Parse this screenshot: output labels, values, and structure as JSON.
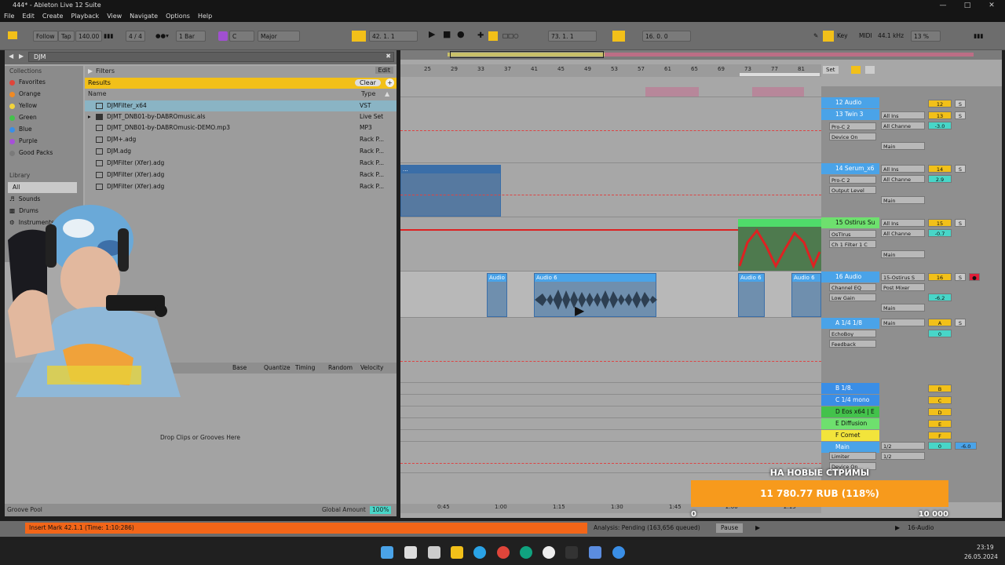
{
  "window": {
    "title": "444* - Ableton Live 12 Suite"
  },
  "menu": [
    "File",
    "Edit",
    "Create",
    "Playback",
    "View",
    "Navigate",
    "Options",
    "Help"
  ],
  "control_bar": {
    "follow": "Follow",
    "tap": "Tap",
    "tempo": "140.00",
    "time_signature": "4 / 4",
    "quantize": "1 Bar",
    "key": "C",
    "scale": "Major",
    "arrangement_position": "42.   1.   1",
    "loop_start": "73.   1.   1",
    "loop_length": "16.   0.   0",
    "key_label": "Key",
    "midi_label": "MIDI",
    "sample_rate": "44.1 kHz",
    "cpu": "13 %"
  },
  "browser": {
    "search": "DJM",
    "collections_label": "Collections",
    "collections": [
      {
        "label": "Favorites",
        "color": "#e0453a"
      },
      {
        "label": "Orange",
        "color": "#f08a24"
      },
      {
        "label": "Yellow",
        "color": "#f2d43b"
      },
      {
        "label": "Green",
        "color": "#43c24b"
      },
      {
        "label": "Blue",
        "color": "#3a8ee6"
      },
      {
        "label": "Purple",
        "color": "#a650d8"
      },
      {
        "label": "Good Packs",
        "color": "#7a7a7a"
      }
    ],
    "library_label": "Library",
    "library": [
      "All",
      "Sounds",
      "Drums",
      "Instruments"
    ],
    "filters_label": "Filters",
    "edit_label": "Edit",
    "results_label": "Results",
    "clear_label": "Clear",
    "col_name": "Name",
    "col_type": "Type",
    "results": [
      {
        "name": "DJMFilter_x64",
        "type": "VST"
      },
      {
        "name": "DJMT_DNB01-by-DABROmusic.als",
        "type": "Live Set"
      },
      {
        "name": "DJMT_DNB01-by-DABROmusic-DEMO.mp3",
        "type": "MP3"
      },
      {
        "name": "DJM+.adg",
        "type": "Rack P..."
      },
      {
        "name": "DJM.adg",
        "type": "Rack P..."
      },
      {
        "name": "DJMFilter (Xfer).adg",
        "type": "Rack P..."
      },
      {
        "name": "DJMFilter (Xfer).adg",
        "type": "Rack P..."
      },
      {
        "name": "DJMFilter (Xfer).adg",
        "type": "Rack P..."
      }
    ]
  },
  "groove": {
    "cols": [
      "Base",
      "Quantize",
      "Timing",
      "Random",
      "Velocity"
    ],
    "drop_text": "Drop Clips or Grooves Here",
    "pool_label": "Groove Pool",
    "global_amount_label": "Global Amount",
    "global_amount": "100%"
  },
  "ruler": {
    "bars": [
      "25",
      "29",
      "33",
      "37",
      "41",
      "45",
      "49",
      "53",
      "57",
      "61",
      "65",
      "69",
      "73",
      "77",
      "81"
    ],
    "times": [
      "0:45",
      "1:00",
      "1:15",
      "1:30",
      "1:45",
      "2:00",
      "2:15"
    ],
    "set_label": "Set"
  },
  "tracks": [
    {
      "name": "12 Audio",
      "color": "#4aa3e8",
      "num": "12",
      "vol": "",
      "dev1": "",
      "dev2": ""
    },
    {
      "name": "13 Twin 3",
      "color": "#4aa3e8",
      "num": "13",
      "input": "All Ins",
      "chan": "All Channe",
      "vol": "-3.0",
      "dev1": "Pro-C 2",
      "dev2": "Device On",
      "out": "Main"
    },
    {
      "name": "14 Serum_x6",
      "color": "#4aa3e8",
      "num": "14",
      "input": "All Ins",
      "chan": "All Channe",
      "vol": "2.9",
      "dev1": "Pro-C 2",
      "dev2": "Output Level",
      "out": "Main"
    },
    {
      "name": "15 Ostirus Su",
      "color": "#6ee06e",
      "num": "15",
      "input": "All Ins",
      "chan": "All Channe",
      "vol": "-0.7",
      "dev1": "OsTIrus",
      "dev2": "Ch 1 Filter 1 C",
      "out": "Main"
    },
    {
      "name": "16 Audio",
      "color": "#4aa3e8",
      "num": "16",
      "input": "15-Ostirus S",
      "chan": "Post Mixer",
      "vol": "-6.2",
      "dev1": "Channel EQ",
      "dev2": "Low Gain",
      "out": "Main"
    },
    {
      "name": "A 1/4  1/8",
      "color": "#4aa3e8",
      "num": "A",
      "input": "Main",
      "vol": "0",
      "dev1": "EchoBoy",
      "dev2": "Feedback"
    }
  ],
  "returns": [
    {
      "name": "B 1/8.",
      "color": "#3a8ee6",
      "letter": "B"
    },
    {
      "name": "C 1/4 mono",
      "color": "#3a8ee6",
      "letter": "C"
    },
    {
      "name": "D Eos x64 | E",
      "color": "#43c24b",
      "letter": "D"
    },
    {
      "name": "E Diffusion",
      "color": "#6ee06e",
      "letter": "E"
    },
    {
      "name": "F Comet",
      "color": "#f2e43b",
      "letter": "F"
    }
  ],
  "main_track": {
    "name": "Main",
    "in": "1/2",
    "out": "1/2",
    "vol": "0",
    "pan": "-6.0",
    "dev1": "Limiter",
    "dev2": "Device On"
  },
  "clips": {
    "audio_label": "Audio",
    "audio6_label": "Audio 6",
    "serum_label": "..."
  },
  "stream": {
    "title": "НА НОВЫЕ СТРИМЫ",
    "amount": "11 780.77 RUB (118%)",
    "min": "0",
    "max": "10 000",
    "progress": 1.18
  },
  "status": {
    "message": "Insert Mark 42.1.1 (Time: 1:10:286)",
    "analysis": "Analysis: Pending (163,656 queued)",
    "pause": "Pause",
    "track": "16-Audio"
  },
  "taskbar": {
    "time": "23:19",
    "date": "26.05.2024"
  }
}
